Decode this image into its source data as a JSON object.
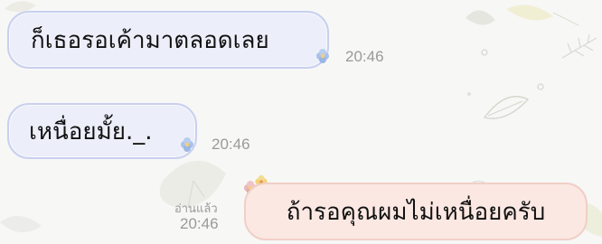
{
  "chat": {
    "messages": [
      {
        "direction": "incoming",
        "text": "ก็เธอรอเค้ามาตลอดเลย",
        "time": "20:46"
      },
      {
        "direction": "incoming",
        "text": "เหนื่อยมั้ย._.",
        "time": "20:46"
      },
      {
        "direction": "outgoing",
        "text": "ถ้ารอคุณผมไม่เหนื่อยครับ",
        "time": "20:46",
        "read_label": "อ่านแล้ว"
      }
    ]
  },
  "colors": {
    "incoming_bubble": "#eceffa",
    "incoming_border": "#c9d0ee",
    "outgoing_bubble": "#fbe8e3",
    "outgoing_border": "#f0cfc6",
    "timestamp": "#9a9a9a"
  },
  "icons": {
    "bubble_decoration": "flower-icon",
    "background_pattern": "leaf-pattern"
  }
}
